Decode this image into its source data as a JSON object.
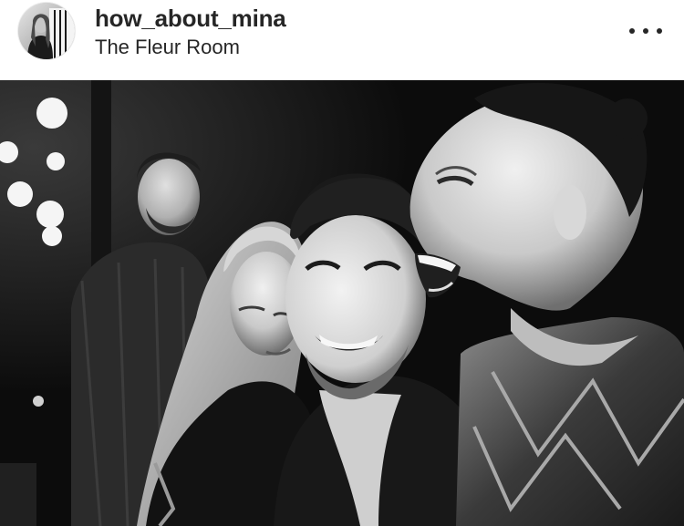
{
  "post": {
    "username": "how_about_mina",
    "location": "The Fleur Room",
    "avatar_alt": "profile photo",
    "photo_alt": "black and white photo of three people laughing at a bar",
    "more_icon": "more-horizontal-icon"
  },
  "colors": {
    "text": "#262626",
    "background": "#ffffff",
    "photo_base": "#0d0d0d"
  }
}
